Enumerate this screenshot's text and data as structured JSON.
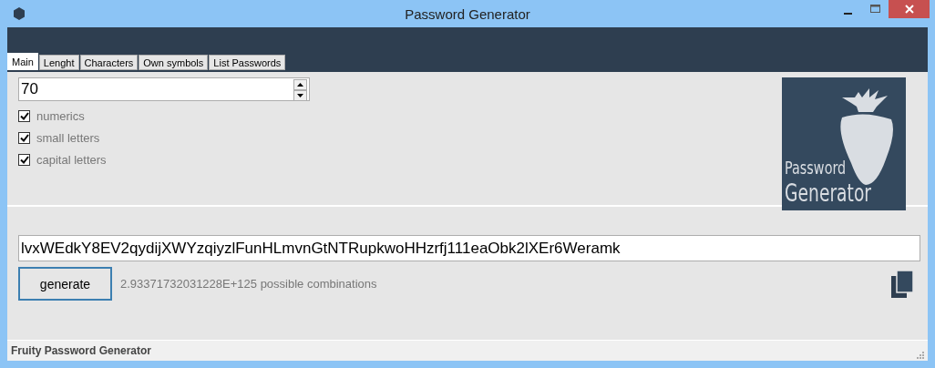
{
  "window": {
    "title": "Password Generator"
  },
  "tabs": [
    {
      "label": "Main",
      "selected": true
    },
    {
      "label": "Lenght",
      "selected": false
    },
    {
      "label": "Characters",
      "selected": false
    },
    {
      "label": "Own symbols",
      "selected": false
    },
    {
      "label": "List Passwords",
      "selected": false
    }
  ],
  "length": {
    "value": "70"
  },
  "options": [
    {
      "label": "numerics",
      "checked": true
    },
    {
      "label": "small letters",
      "checked": true
    },
    {
      "label": "capital letters",
      "checked": true
    }
  ],
  "logo": {
    "line_1": "Password",
    "line_2": "Generator"
  },
  "password": {
    "value": "lvxWEdkY8EV2qydijXWYzqiyzlFunHLmvnGtNTRupkwoHHzrfj111eaObk2lXEr6Weramk"
  },
  "generate_button": "generate",
  "combinations": "2.93371732031228E+125 possible combinations",
  "status_bar": "Fruity Password Generator"
}
